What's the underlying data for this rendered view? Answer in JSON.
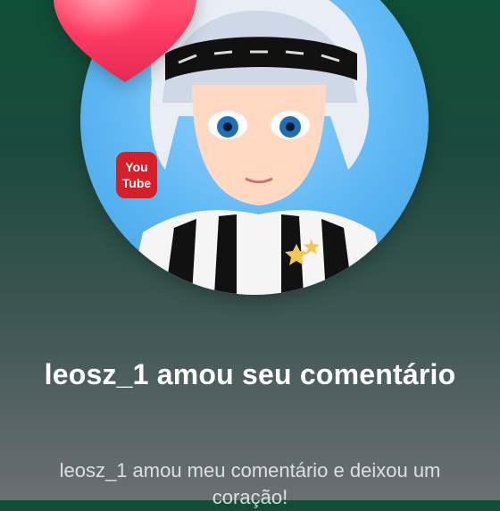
{
  "notification": {
    "title": "leosz_1 amou seu comentário",
    "subtitle": "leosz_1 amou meu comentário e deixou um coração!"
  },
  "icons": {
    "reaction": "heart-icon",
    "badge": "youtube-logo-icon"
  },
  "colors": {
    "heart": "#ff4b6e",
    "background_top": "#0f4f36",
    "background_bottom": "#6b6f73",
    "avatar_sky": "#5db7f3"
  },
  "badge": {
    "line1": "You",
    "line2": "Tube"
  }
}
